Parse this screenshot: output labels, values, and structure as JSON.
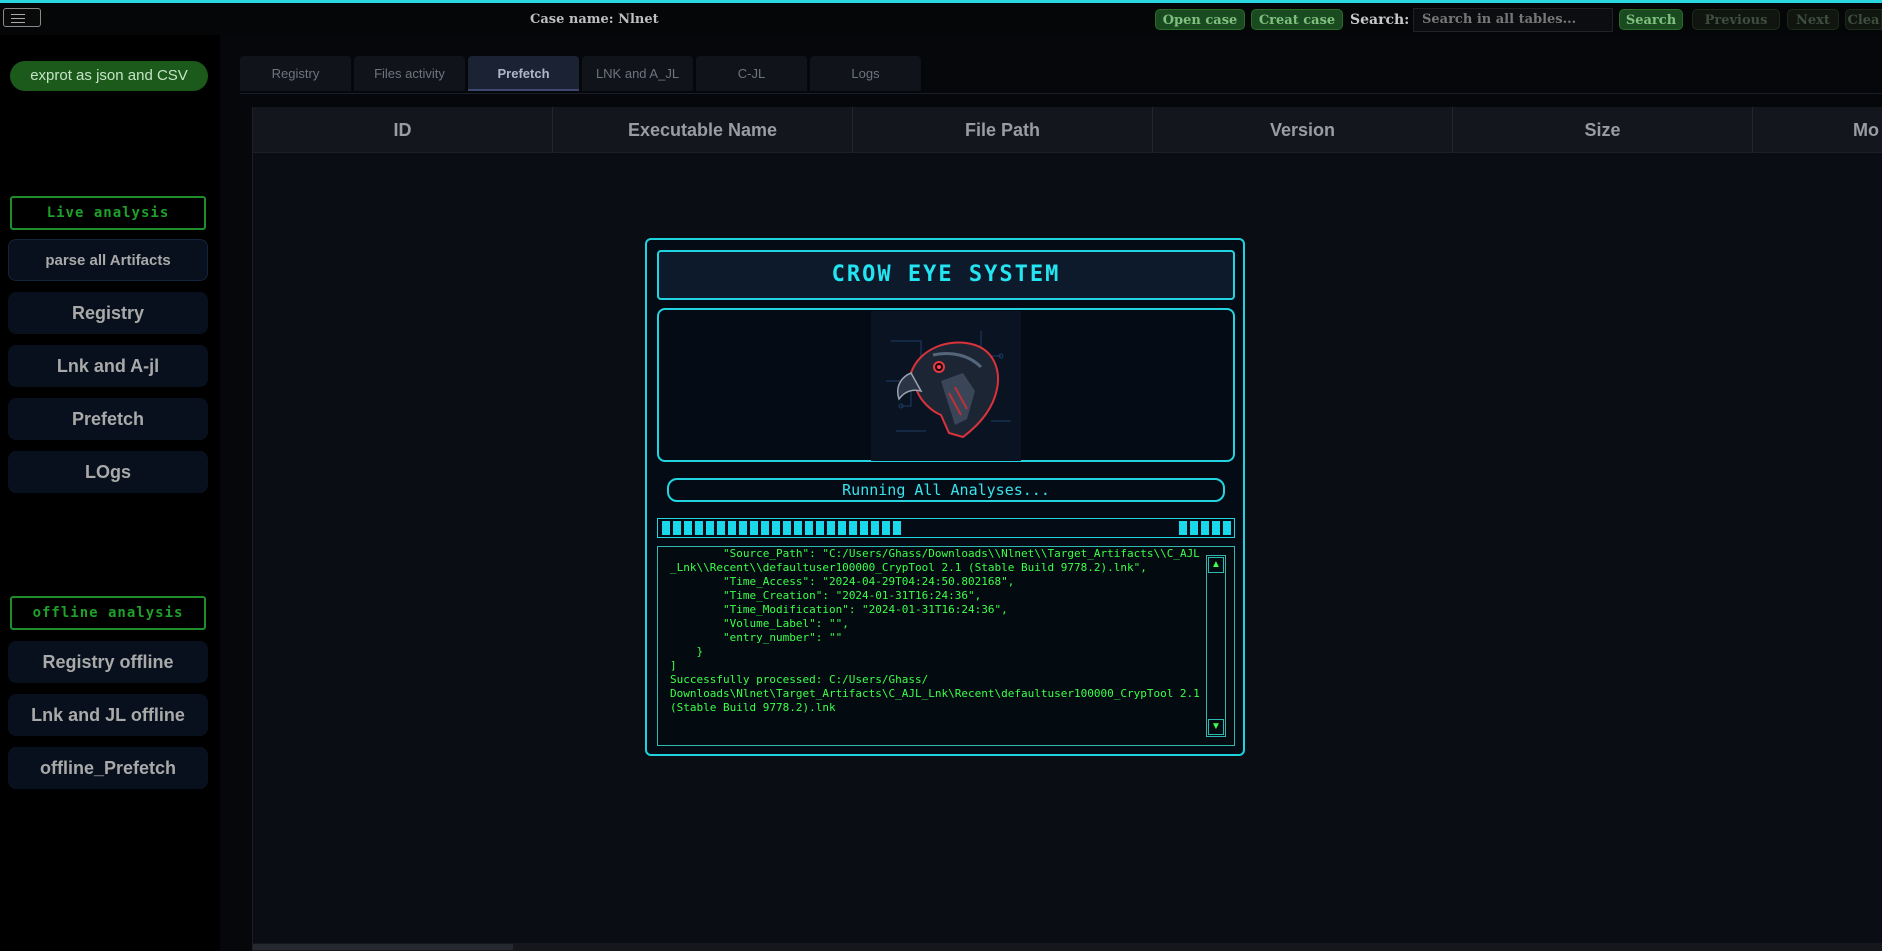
{
  "header": {
    "case_label": "Case name: Nlnet",
    "open_case": "Open case",
    "create_case": "Creat case",
    "search_label": "Search:",
    "search_placeholder": "Search in all tables...",
    "search_button": "Search",
    "previous_button": "Previous",
    "next_button": "Next",
    "clear_button": "Clea"
  },
  "sidebar": {
    "export_button": "exprot as json and CSV",
    "live_section": "Live analysis",
    "live_items": [
      "parse all Artifacts",
      "Registry",
      "Lnk and A-jl",
      "Prefetch",
      "LOgs"
    ],
    "offline_section": "offline analysis",
    "offline_items": [
      "Registry offline",
      "Lnk and JL offline",
      "offline_Prefetch"
    ]
  },
  "tabs": [
    {
      "label": "Registry",
      "active": false
    },
    {
      "label": "Files activity",
      "active": false
    },
    {
      "label": "Prefetch",
      "active": true
    },
    {
      "label": "LNK and A_JL",
      "active": false
    },
    {
      "label": "C-JL",
      "active": false
    },
    {
      "label": "Logs",
      "active": false
    }
  ],
  "table": {
    "columns": [
      "ID",
      "Executable Name",
      "File Path",
      "Version",
      "Size",
      "Mo"
    ]
  },
  "modal": {
    "title": "CROW EYE SYSTEM",
    "status": "Running All Analyses...",
    "progress_left_blocks": 22,
    "progress_right_blocks": 5,
    "log": "        \"Source_Path\": \"C:/Users/Ghass/Downloads\\\\Nlnet\\\\Target_Artifacts\\\\C_AJL_Lnk\\\\Recent\\\\defaultuser100000_CrypTool 2.1 (Stable Build 9778.2).lnk\",\n        \"Time_Access\": \"2024-04-29T04:24:50.802168\",\n        \"Time_Creation\": \"2024-01-31T16:24:36\",\n        \"Time_Modification\": \"2024-01-31T16:24:36\",\n        \"Volume_Label\": \"\",\n        \"entry_number\": \"\"\n    }\n]\nSuccessfully processed: C:/Users/Ghass/\nDownloads\\Nlnet\\Target_Artifacts\\C_AJL_Lnk\\Recent\\defaultuser100000_CrypTool 2.1 (Stable Build 9778.2).lnk",
    "scroll_up": "▲",
    "scroll_down": "▼"
  },
  "colors": {
    "accent_cyan": "#1ed2de",
    "log_green": "#3dff4a",
    "button_green": "#1c5a1c"
  }
}
